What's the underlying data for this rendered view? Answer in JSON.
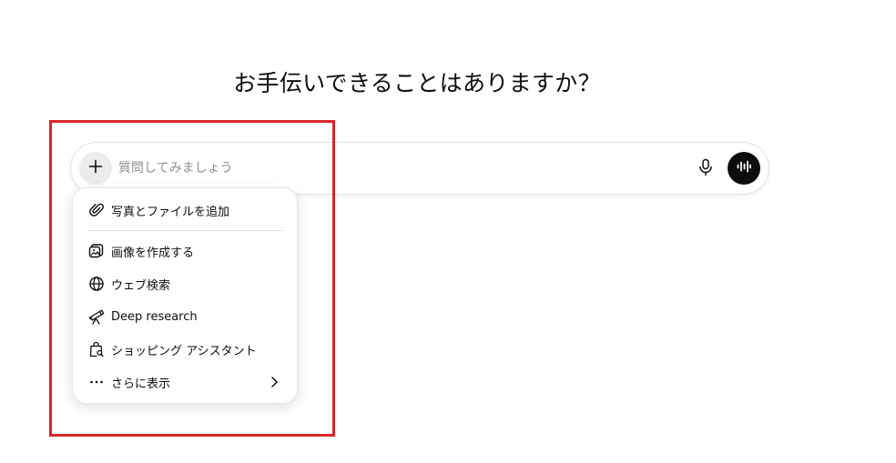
{
  "headline": "お手伝いできることはありますか？",
  "composer": {
    "placeholder": "質問してみましょう"
  },
  "menu": {
    "items": [
      {
        "label": "写真とファイルを追加",
        "icon": "paperclip-icon"
      },
      {
        "label": "画像を作成する",
        "icon": "image-create-icon"
      },
      {
        "label": "ウェブ検索",
        "icon": "globe-icon"
      },
      {
        "label": "Deep research",
        "icon": "telescope-icon"
      },
      {
        "label": "ショッピング アシスタント",
        "icon": "shopping-bag-search-icon"
      },
      {
        "label": "さらに表示",
        "icon": "more-horizontal-icon",
        "has_submenu": true
      }
    ]
  },
  "colors": {
    "highlight": "#d9262b",
    "voice_button": "#0d0d0d",
    "plus_button_bg": "#ececec",
    "placeholder": "#8f8f8f"
  }
}
